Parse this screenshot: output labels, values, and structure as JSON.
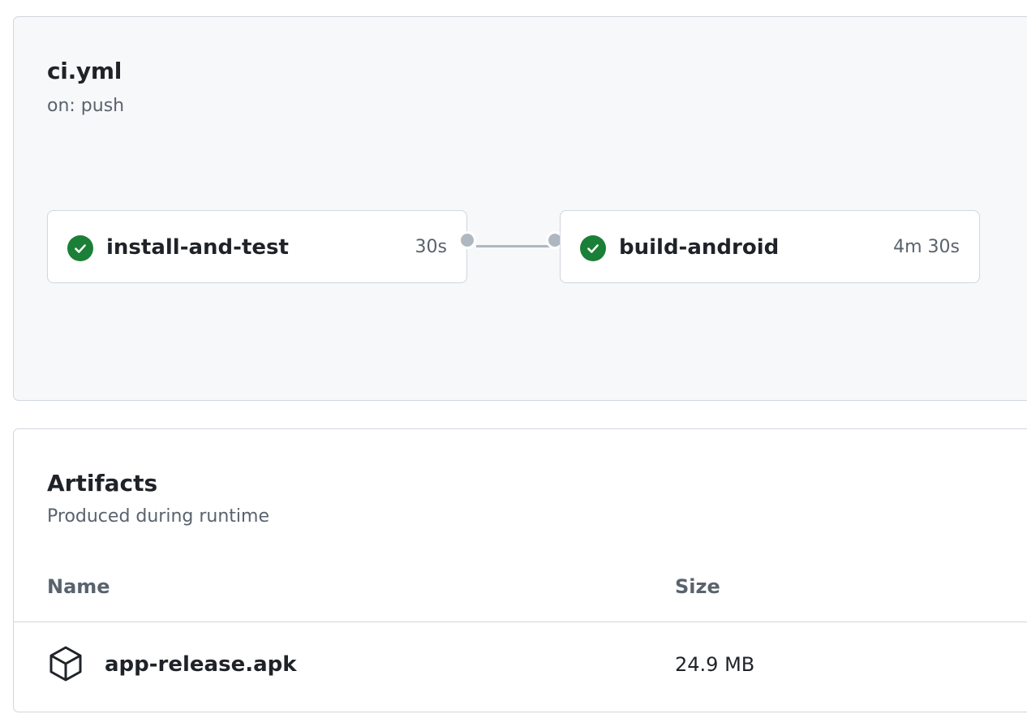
{
  "workflow": {
    "title": "ci.yml",
    "trigger": "on: push",
    "jobs": [
      {
        "name": "install-and-test",
        "duration": "30s",
        "status": "success",
        "icon": "check-circle-icon"
      },
      {
        "name": "build-android",
        "duration": "4m 30s",
        "status": "success",
        "icon": "check-circle-icon"
      }
    ]
  },
  "artifacts": {
    "title": "Artifacts",
    "subtitle": "Produced during runtime",
    "columns": {
      "name": "Name",
      "size": "Size"
    },
    "rows": [
      {
        "name": "app-release.apk",
        "size": "24.9 MB",
        "icon": "package-icon"
      }
    ]
  },
  "colors": {
    "success": "#1a7f37",
    "panel_bg": "#f6f8fa",
    "border": "#d0d7de",
    "muted_text": "#59636e",
    "connector": "#afb8c1"
  }
}
